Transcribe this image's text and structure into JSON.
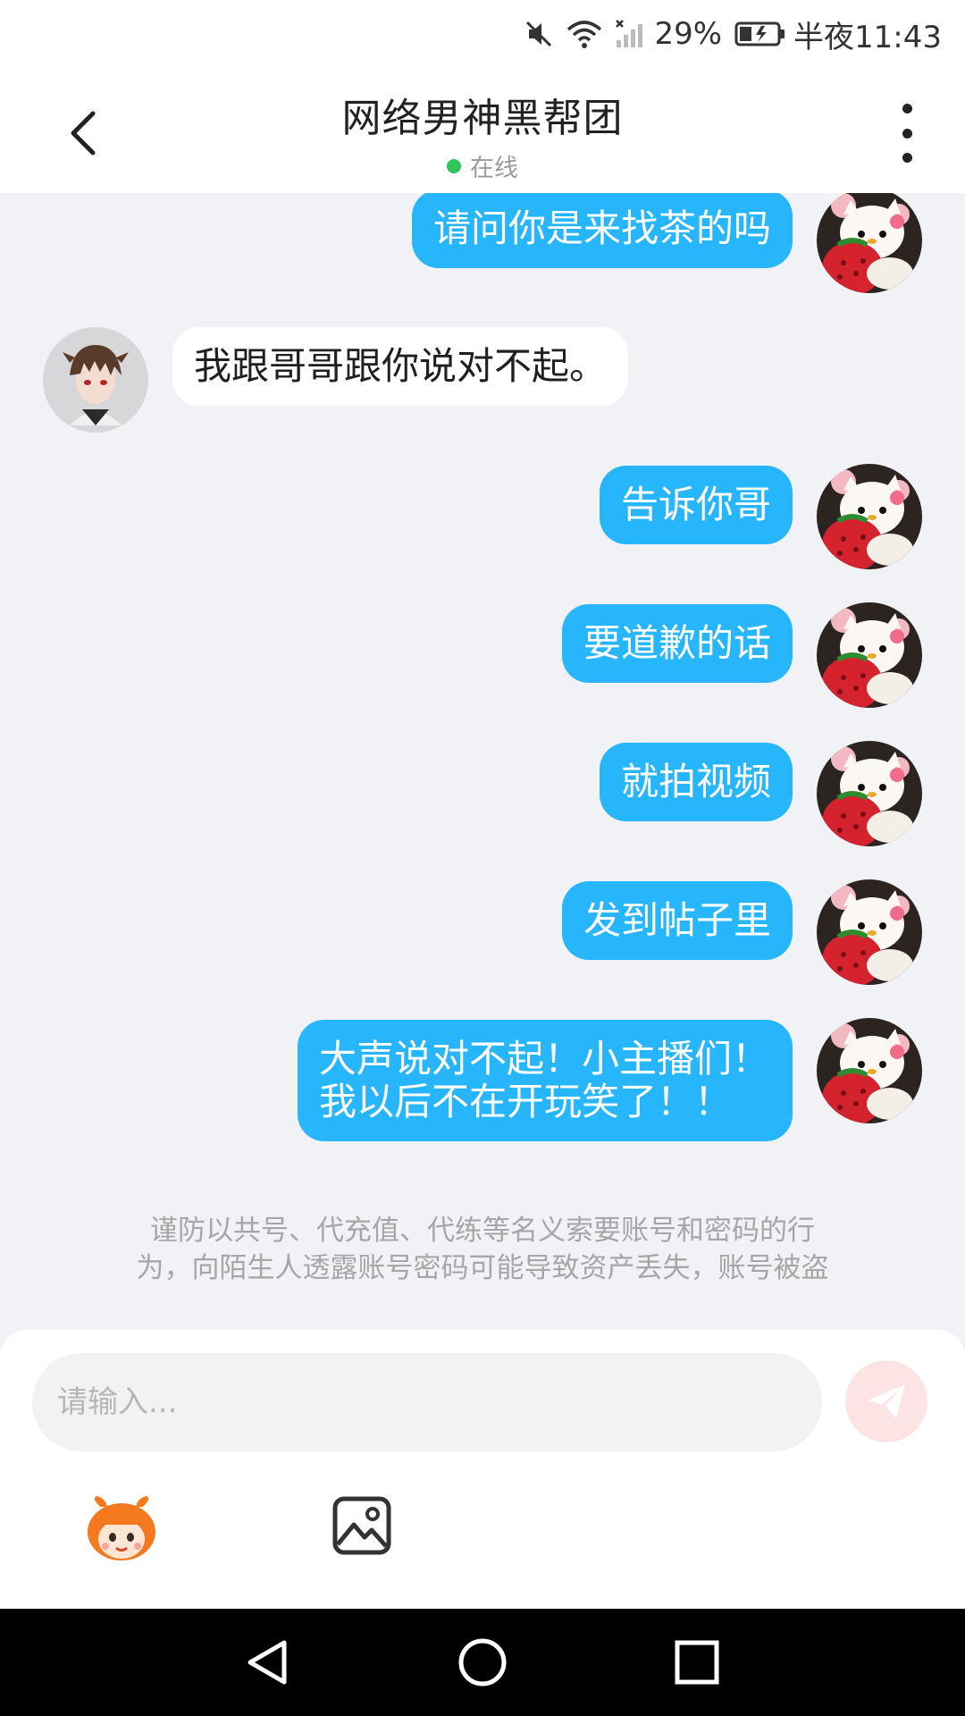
{
  "status_bar": {
    "battery": "29%",
    "time": "半夜11:43"
  },
  "header": {
    "title": "网络男神黑帮团",
    "status": "在线"
  },
  "messages": [
    {
      "side": "out",
      "text": "请问你是来找茶的吗"
    },
    {
      "side": "in",
      "text": "我跟哥哥跟你说对不起。"
    },
    {
      "side": "out",
      "text": "告诉你哥"
    },
    {
      "side": "out",
      "text": "要道歉的话"
    },
    {
      "side": "out",
      "text": "就拍视频"
    },
    {
      "side": "out",
      "text": "发到帖子里"
    },
    {
      "side": "out",
      "text_line1": "大声说对不起！小主播们！",
      "text_line2": "我以后不在开玩笑了！！"
    }
  ],
  "notice": {
    "line1": "谨防以共号、代充值、代练等名义索要账号和密码的行",
    "line2": "为，向陌生人透露账号密码可能导致资产丢失，账号被盗"
  },
  "input": {
    "placeholder": "请输入..."
  },
  "icons": {
    "back": "chevron-left-icon",
    "more": "more-vertical-icon",
    "send": "paper-plane-icon",
    "emoji": "mascot-emoji-icon",
    "image": "image-icon"
  },
  "colors": {
    "outgoing_bubble": "#27b5fb",
    "incoming_bubble": "#ffffff",
    "online_dot": "#2ec55a",
    "send_button": "#fde4e4"
  }
}
